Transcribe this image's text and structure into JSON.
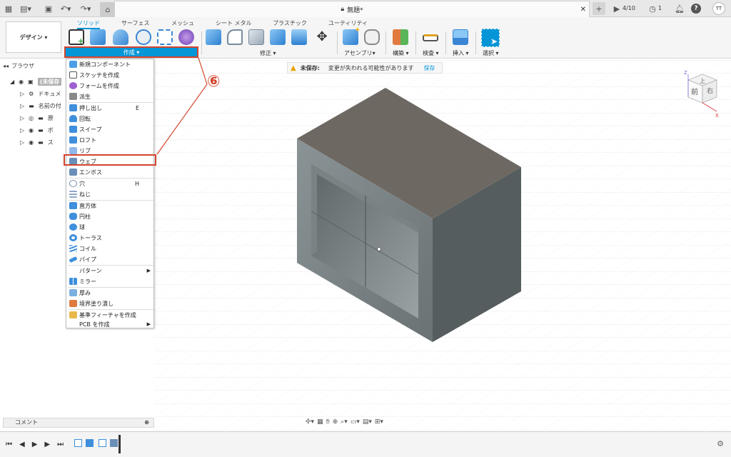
{
  "titlebar": {
    "doc_title": "無題*",
    "job_count": "4/10",
    "notif_count": "1",
    "user_initials": "TT"
  },
  "ribbon": {
    "workspace_label": "デザイン ▾",
    "tabs": [
      "ソリッド",
      "サーフェス",
      "メッシュ",
      "シート メタル",
      "プラスチック",
      "ユーティリティ"
    ],
    "groups": {
      "create": "作成 ▾",
      "modify": "修正 ▾",
      "assemble": "アセンブリ▾",
      "construct": "構築 ▾",
      "inspect": "検査 ▾",
      "insert": "挿入 ▾",
      "select": "選択 ▾"
    }
  },
  "browser": {
    "title": "ブラウザ",
    "rows": [
      {
        "label": "(未保存"
      },
      {
        "label": "ドキュメ"
      },
      {
        "label": "名前の付"
      },
      {
        "label": "原"
      },
      {
        "label": "ボ"
      },
      {
        "label": "ス"
      }
    ]
  },
  "warning": {
    "label": "未保存:",
    "message": "変更が失われる可能性があります",
    "save_link": "保存"
  },
  "annotation": {
    "marker": "⑥"
  },
  "create_menu": {
    "items": [
      {
        "label": "新規コンポーネント",
        "color": "#4c9ee6"
      },
      {
        "label": "スケッチを作成",
        "color": "#7aa87a"
      },
      {
        "label": "フォームを作成",
        "color": "#a05fd0"
      },
      {
        "label": "派生",
        "color": "#888"
      },
      {
        "label": "押し出し",
        "shortcut": "E",
        "color": "#3f8fdc"
      },
      {
        "label": "回転",
        "color": "#3f8fdc"
      },
      {
        "label": "スイープ",
        "color": "#3f8fdc"
      },
      {
        "label": "ロフト",
        "color": "#3f8fdc"
      },
      {
        "label": "リブ",
        "color": "#8fb8e8"
      },
      {
        "label": "ウェブ",
        "color": "#6a8fb8"
      },
      {
        "label": "エンボス",
        "color": "#6a8fb8"
      },
      {
        "label": "穴",
        "shortcut": "H",
        "color": "#7a8fa8"
      },
      {
        "label": "ねじ",
        "color": "#8fa8c8"
      },
      {
        "label": "直方体",
        "color": "#3f8fdc"
      },
      {
        "label": "円柱",
        "color": "#3f8fdc"
      },
      {
        "label": "球",
        "color": "#3f8fdc"
      },
      {
        "label": "トーラス",
        "color": "#3f8fdc"
      },
      {
        "label": "コイル",
        "color": "#3f8fdc"
      },
      {
        "label": "パイプ",
        "color": "#3f8fdc"
      },
      {
        "label": "パターン"
      },
      {
        "label": "ミラー",
        "color": "#3f8fdc"
      },
      {
        "label": "厚み",
        "color": "#7ab0e0"
      },
      {
        "label": "境界塗り潰し",
        "color": "#e07a3f"
      },
      {
        "label": "基準フィーチャを作成",
        "color": "#e8b84c"
      },
      {
        "label": "PCB を作成"
      }
    ]
  },
  "viewcube": {
    "top": "上",
    "front": "前",
    "right": "右",
    "axis_z": "Z",
    "axis_x": "X"
  },
  "comments": {
    "label": "コメント"
  },
  "colors": {
    "accent": "#0696d7",
    "highlight": "#d2452e",
    "body_top": "#6e6862",
    "body_right": "#555d5e",
    "body_front": "#7b8385"
  }
}
